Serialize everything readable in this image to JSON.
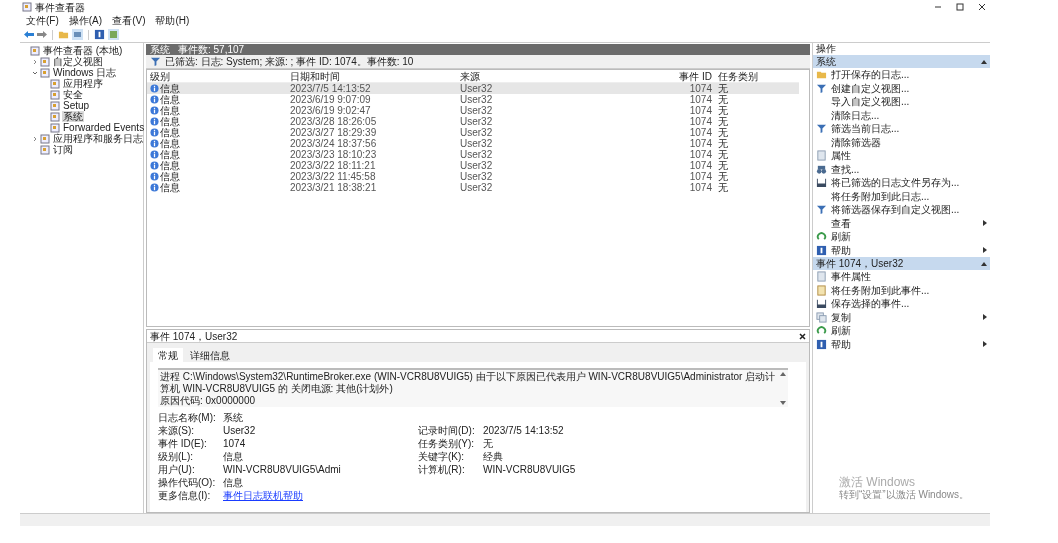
{
  "window": {
    "title": "事件查看器"
  },
  "menu": [
    "文件(F)",
    "操作(A)",
    "查看(V)",
    "帮助(H)"
  ],
  "tree": {
    "label": "事件查看器 (本地)",
    "selected": false,
    "children": [
      {
        "label": "自定义视图",
        "expanded": false,
        "selected": false
      },
      {
        "label": "Windows 日志",
        "expanded": true,
        "selected": false,
        "children": [
          {
            "label": "应用程序",
            "selected": false
          },
          {
            "label": "安全",
            "selected": false
          },
          {
            "label": "Setup",
            "selected": false
          },
          {
            "label": "系统",
            "selected": true
          },
          {
            "label": "Forwarded Events",
            "selected": false
          }
        ]
      },
      {
        "label": "应用程序和服务日志",
        "expanded": false,
        "selected": false
      },
      {
        "label": "订阅",
        "selected": false
      }
    ]
  },
  "list_header": {
    "title": "系统",
    "count": "事件数: 57,107"
  },
  "filter": "已筛选: 日志: System; 来源: ; 事件 ID: 1074。事件数: 10",
  "table": {
    "columns": [
      "级别",
      "日期和时间",
      "来源",
      "事件 ID",
      "任务类别"
    ],
    "rows": [
      {
        "level": "信息",
        "date": "2023/7/5 14:13:52",
        "source": "User32",
        "id": "1074",
        "task": "无",
        "selected": true
      },
      {
        "level": "信息",
        "date": "2023/6/19 9:07:09",
        "source": "User32",
        "id": "1074",
        "task": "无",
        "selected": false
      },
      {
        "level": "信息",
        "date": "2023/6/19 9:02:47",
        "source": "User32",
        "id": "1074",
        "task": "无",
        "selected": false
      },
      {
        "level": "信息",
        "date": "2023/3/28 18:26:05",
        "source": "User32",
        "id": "1074",
        "task": "无",
        "selected": false
      },
      {
        "level": "信息",
        "date": "2023/3/27 18:29:39",
        "source": "User32",
        "id": "1074",
        "task": "无",
        "selected": false
      },
      {
        "level": "信息",
        "date": "2023/3/24 18:37:56",
        "source": "User32",
        "id": "1074",
        "task": "无",
        "selected": false
      },
      {
        "level": "信息",
        "date": "2023/3/23 18:10:23",
        "source": "User32",
        "id": "1074",
        "task": "无",
        "selected": false
      },
      {
        "level": "信息",
        "date": "2023/3/22 18:11:21",
        "source": "User32",
        "id": "1074",
        "task": "无",
        "selected": false
      },
      {
        "level": "信息",
        "date": "2023/3/22 11:45:58",
        "source": "User32",
        "id": "1074",
        "task": "无",
        "selected": false
      },
      {
        "level": "信息",
        "date": "2023/3/21 18:38:21",
        "source": "User32",
        "id": "1074",
        "task": "无",
        "selected": false
      }
    ]
  },
  "detail": {
    "title": "事件 1074，User32",
    "tabs": [
      {
        "label": "常规",
        "selected": true
      },
      {
        "label": "详细信息",
        "selected": false
      }
    ],
    "message": [
      "进程 C:\\Windows\\System32\\RuntimeBroker.exe (WIN-VCR8U8VUIG5) 由于以下原因已代表用户 WIN-VCR8U8VUIG5\\Administrator 启动计算机 WIN-VCR8U8VUIG5 的 关闭电源: 其他(计划外)",
      "原因代码: 0x0000000"
    ],
    "fields": [
      [
        {
          "label": "日志名称(M):",
          "value": "系统"
        }
      ],
      [
        {
          "label": "来源(S):",
          "value": "User32"
        },
        {
          "label": "记录时间(D):",
          "value": "2023/7/5 14:13:52"
        }
      ],
      [
        {
          "label": "事件 ID(E):",
          "value": "1074"
        },
        {
          "label": "任务类别(Y):",
          "value": "无"
        }
      ],
      [
        {
          "label": "级别(L):",
          "value": "信息"
        },
        {
          "label": "关键字(K):",
          "value": "经典"
        }
      ],
      [
        {
          "label": "用户(U):",
          "value": "WIN-VCR8U8VUIG5\\Admi"
        },
        {
          "label": "计算机(R):",
          "value": "WIN-VCR8U8VUIG5"
        }
      ],
      [
        {
          "label": "操作代码(O):",
          "value": "信息"
        }
      ],
      [
        {
          "label": "更多信息(I):",
          "value": "事件日志联机帮助",
          "kind": "link"
        }
      ]
    ]
  },
  "actions": {
    "title": "操作",
    "sections": [
      {
        "title": "系统",
        "items": [
          {
            "label": "打开保存的日志...",
            "kind": "folder"
          },
          {
            "label": "创建自定义视图...",
            "kind": "filter"
          },
          {
            "label": "导入自定义视图..."
          },
          {
            "label": "清除日志..."
          },
          {
            "label": "筛选当前日志...",
            "kind": "filter"
          },
          {
            "label": "清除筛选器"
          },
          {
            "label": "属性",
            "kind": "page"
          },
          {
            "label": "查找...",
            "kind": "binoculars"
          },
          {
            "label": "将已筛选的日志文件另存为...",
            "kind": "save"
          },
          {
            "label": "将任务附加到此日志..."
          },
          {
            "label": "将筛选器保存到自定义视图...",
            "kind": "filter"
          },
          {
            "label": "查看",
            "submenu": true
          },
          {
            "label": "刷新",
            "kind": "refresh"
          },
          {
            "label": "帮助",
            "kind": "help",
            "submenu": true
          }
        ]
      },
      {
        "title": "事件 1074，User32",
        "items": [
          {
            "label": "事件属性",
            "kind": "page"
          },
          {
            "label": "将任务附加到此事件...",
            "kind": "task"
          },
          {
            "label": "保存选择的事件...",
            "kind": "save"
          },
          {
            "label": "复制",
            "kind": "copy",
            "submenu": true
          },
          {
            "label": "刷新",
            "kind": "refresh"
          },
          {
            "label": "帮助",
            "kind": "help",
            "submenu": true
          }
        ]
      }
    ]
  },
  "activation": {
    "title": "激活 Windows",
    "hint": "转到“设置”以激活 Windows。"
  }
}
